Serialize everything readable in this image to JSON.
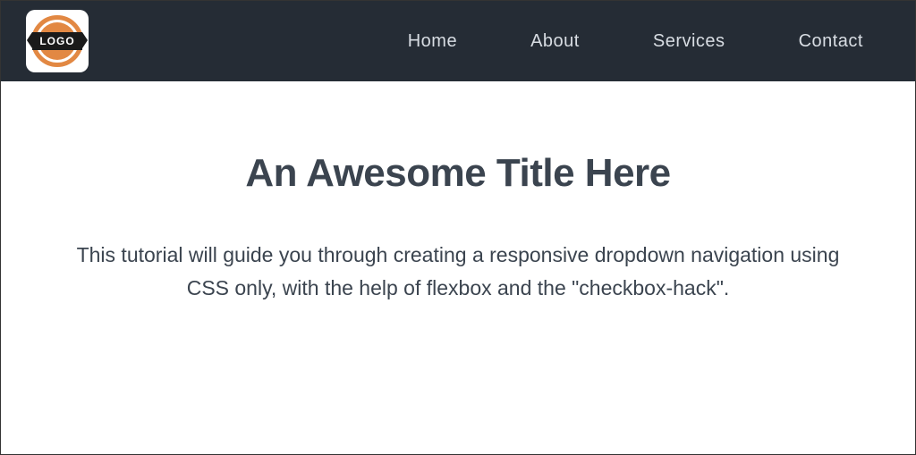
{
  "logo": {
    "text": "LOGO"
  },
  "nav": {
    "items": [
      {
        "label": "Home"
      },
      {
        "label": "About"
      },
      {
        "label": "Services"
      },
      {
        "label": "Contact"
      }
    ]
  },
  "main": {
    "title": "An Awesome Title Here",
    "subtitle": "This tutorial will guide you through creating a responsive dropdown navigation using CSS only, with the help of flexbox and the \"checkbox-hack\"."
  }
}
